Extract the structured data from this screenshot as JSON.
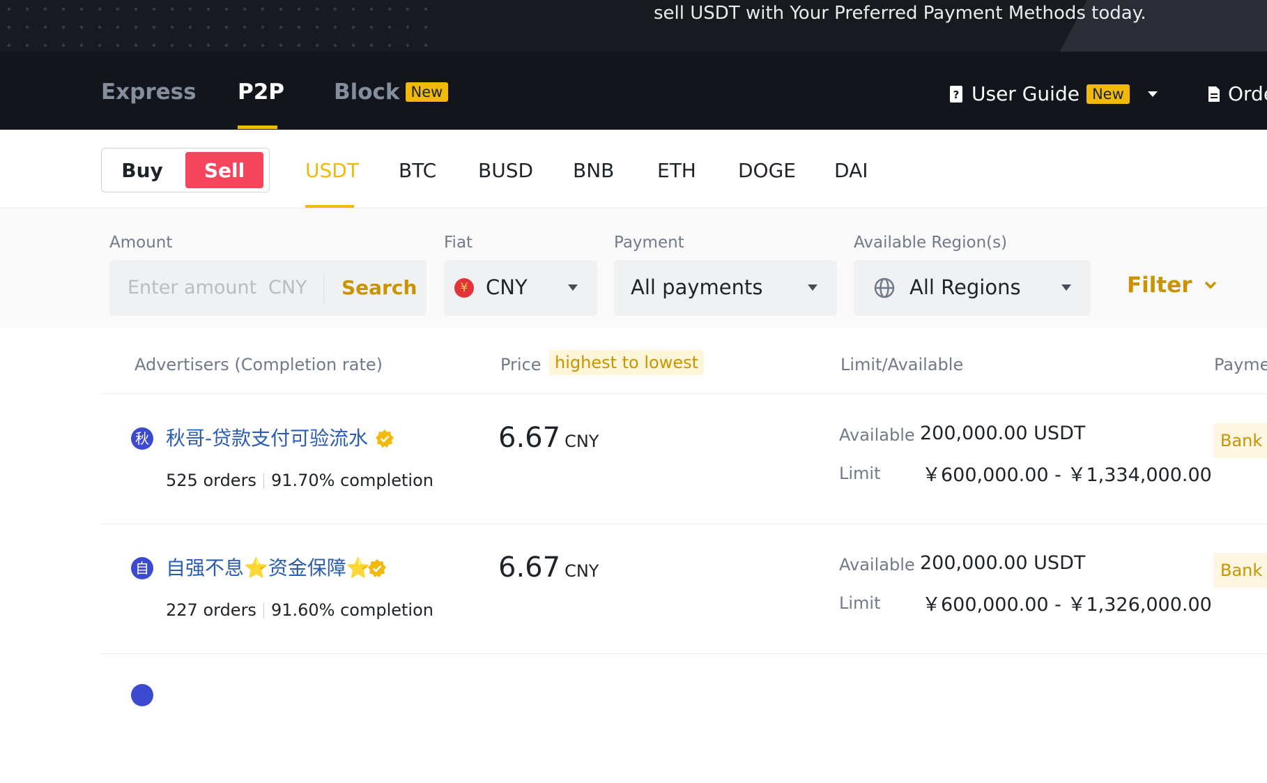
{
  "banner": {
    "text": "sell USDT with Your Preferred Payment Methods today."
  },
  "nav": {
    "tabs": [
      {
        "label": "Express"
      },
      {
        "label": "P2P"
      },
      {
        "label": "Block",
        "badge": "New"
      }
    ],
    "user_guide": {
      "label": "User Guide",
      "badge": "New"
    },
    "orders": {
      "label": "Orde"
    }
  },
  "trade_toggle": {
    "buy": "Buy",
    "sell": "Sell",
    "selected": "Sell"
  },
  "coins": [
    "USDT",
    "BTC",
    "BUSD",
    "BNB",
    "ETH",
    "DOGE",
    "DAI"
  ],
  "selected_coin": "USDT",
  "filters": {
    "amount": {
      "label": "Amount",
      "placeholder": "Enter amount",
      "currency": "CNY",
      "search_label": "Search"
    },
    "fiat": {
      "label": "Fiat",
      "value": "CNY",
      "flag_symbol": "¥"
    },
    "payment": {
      "label": "Payment",
      "value": "All payments"
    },
    "region": {
      "label": "Available Region(s)",
      "value": "All Regions"
    },
    "filter_button": "Filter"
  },
  "table": {
    "headers": {
      "advertisers": "Advertisers (Completion rate)",
      "price": "Price",
      "sort": "highest to lowest",
      "limit": "Limit/Available",
      "payment": "Payme"
    },
    "rows": [
      {
        "avatar_char": "秋",
        "name": "秋哥-贷款支付可验流水",
        "orders": "525 orders",
        "completion": "91.70% completion",
        "price": "6.67",
        "currency": "CNY",
        "available_label": "Available",
        "available": "200,000.00 USDT",
        "limit_label": "Limit",
        "limit": "￥600,000.00 - ￥1,334,000.00",
        "payment": "Bank T"
      },
      {
        "avatar_char": "自",
        "name": "自强不息⭐资金保障⭐",
        "orders": "227 orders",
        "completion": "91.60% completion",
        "price": "6.67",
        "currency": "CNY",
        "available_label": "Available",
        "available": "200,000.00 USDT",
        "limit_label": "Limit",
        "limit": "￥600,000.00 - ￥1,326,000.00",
        "payment": "Bank T"
      }
    ]
  },
  "colors": {
    "accent": "#f0b90b",
    "sell": "#f6465d",
    "nav_bg": "#12161c",
    "link": "#2a5bb5"
  }
}
